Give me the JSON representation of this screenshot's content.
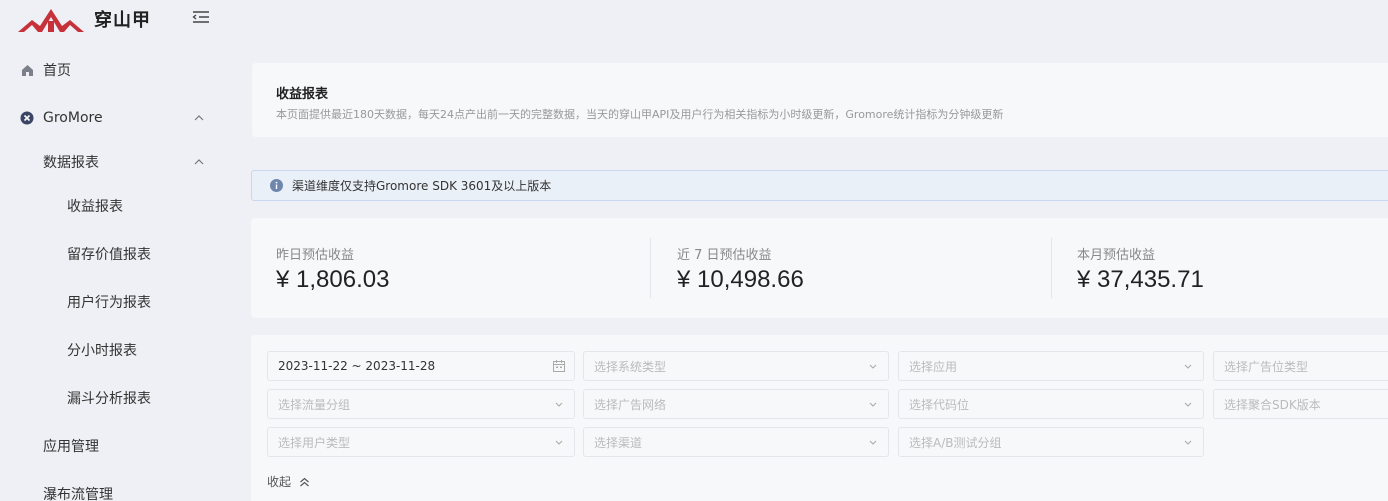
{
  "brand": {
    "name": "穿山甲",
    "accent": "#c6313a"
  },
  "sidebar": {
    "home": {
      "label": "首页",
      "icon": "home-icon"
    },
    "gromore": {
      "label": "GroMore",
      "icon": "gromore-icon"
    },
    "data_reports": {
      "label": "数据报表"
    },
    "items": [
      {
        "label": "收益报表"
      },
      {
        "label": "留存价值报表"
      },
      {
        "label": "用户行为报表"
      },
      {
        "label": "分小时报表"
      },
      {
        "label": "漏斗分析报表"
      }
    ],
    "app_management": {
      "label": "应用管理"
    },
    "waterfall_management": {
      "label": "瀑布流管理"
    }
  },
  "header": {
    "title": "收益报表",
    "description": "本页面提供最近180天数据，每天24点产出前一天的完整数据，当天的穿山甲API及用户行为相关指标为小时级更新，Gromore统计指标为分钟级更新"
  },
  "notice": {
    "text": "渠道维度仅支持Gromore SDK 3601及以上版本",
    "icon": "info-icon"
  },
  "stats": [
    {
      "label": "昨日预估收益",
      "value": "¥ 1,806.03"
    },
    {
      "label": "近 7 日预估收益",
      "value": "¥ 10,498.66"
    },
    {
      "label": "本月预估收益",
      "value": "¥ 37,435.71"
    }
  ],
  "filters": {
    "date_range": "2023-11-22 ~ 2023-11-28",
    "system_type": "选择系统类型",
    "app": "选择应用",
    "ad_slot_type": "选择广告位类型",
    "traffic_group": "选择流量分组",
    "ad_network": "选择广告网络",
    "code_slot": "选择代码位",
    "sdk_version": "选择聚合SDK版本",
    "user_type": "选择用户类型",
    "channel": "选择渠道",
    "ab_group": "选择A/B测试分组"
  },
  "collapse_label": "收起"
}
